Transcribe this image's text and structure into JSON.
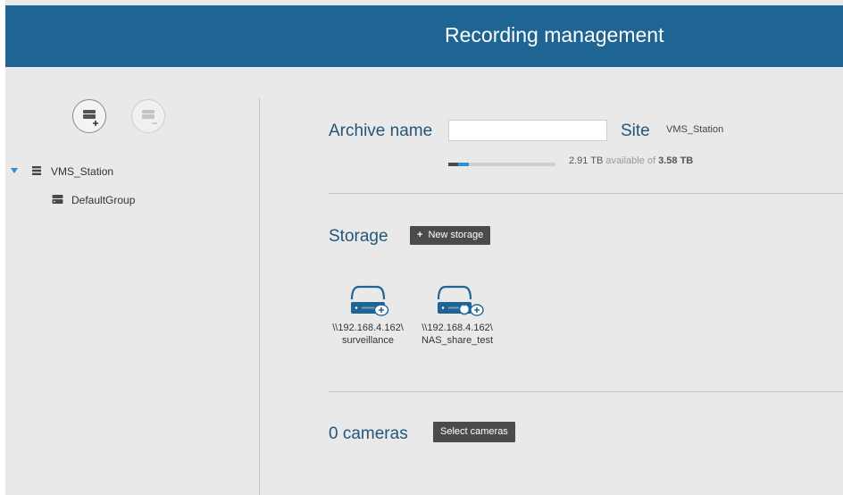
{
  "header": {
    "title": "Recording management"
  },
  "sidebar": {
    "add_button_icon": "add-storage-icon",
    "remove_button_icon": "remove-storage-icon",
    "tree": {
      "root": {
        "label": "VMS_Station",
        "expanded": true
      },
      "children": [
        {
          "label": "DefaultGroup"
        }
      ]
    }
  },
  "archive": {
    "name_label": "Archive name",
    "name_value": "",
    "site_label": "Site",
    "site_value": "VMS_Station",
    "capacity": {
      "available": "2.91 TB",
      "available_suffix": "available of",
      "total": "3.58 TB",
      "used_fraction": 0.19
    }
  },
  "storage": {
    "label": "Storage",
    "new_button": {
      "icon": "+",
      "label": "New storage"
    },
    "items": [
      {
        "path_line1": "\\\\192.168.4.162\\",
        "path_line2": "surveillance",
        "icon": "nas-drive-cloud-icon"
      },
      {
        "path_line1": "\\\\192.168.4.162\\",
        "path_line2": "NAS_share_test",
        "icon": "nas-drive-sync-cloud-icon"
      }
    ]
  },
  "cameras": {
    "label": "0 cameras",
    "select_button": "Select cameras"
  },
  "colors": {
    "header_bg": "#1f6594",
    "accent_text": "#23567a",
    "drive_blue": "#1f6594",
    "button_dark": "#4b4b4b"
  }
}
